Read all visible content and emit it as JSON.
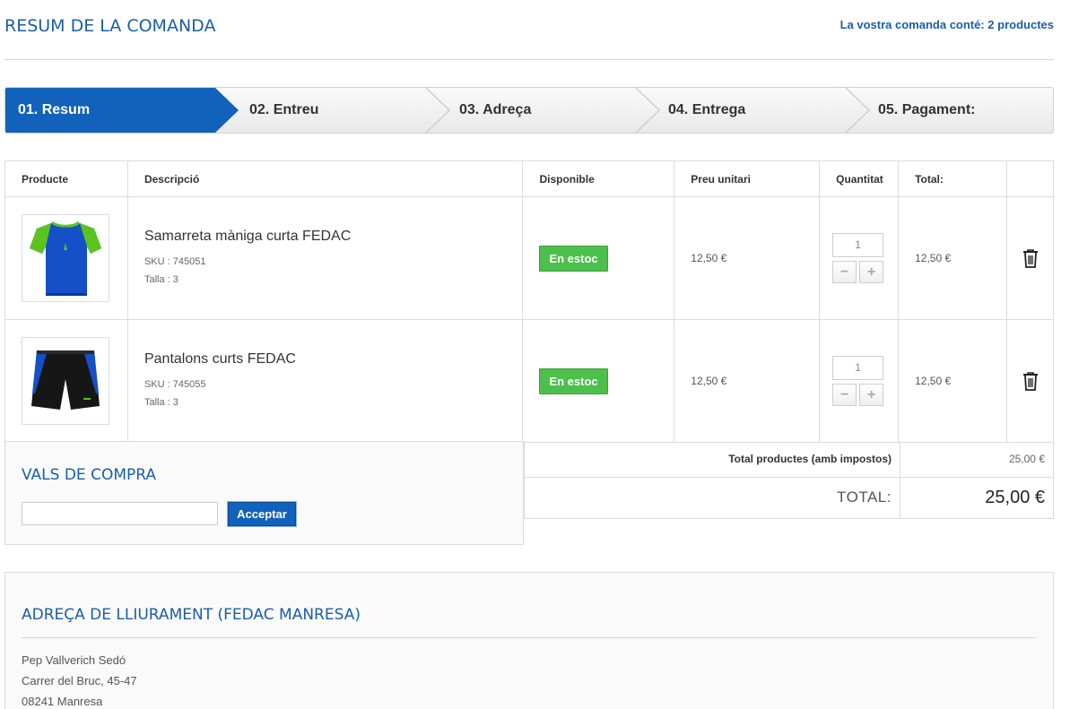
{
  "header": {
    "title": "RESUM DE LA COMANDA",
    "order_count": "La vostra comanda conté: 2 productes"
  },
  "steps": [
    {
      "label": "01. Resum",
      "active": true
    },
    {
      "label": "02. Entreu",
      "active": false
    },
    {
      "label": "03. Adreça",
      "active": false
    },
    {
      "label": "04. Entrega",
      "active": false
    },
    {
      "label": "05. Pagament:",
      "active": false
    }
  ],
  "table": {
    "headers": [
      "Producte",
      "Descripció",
      "Disponible",
      "Preu unitari",
      "Quantitat",
      "Total:"
    ],
    "rows": [
      {
        "image_icon": "tshirt-image",
        "name": "Samarreta màniga curta FEDAC",
        "sku": "SKU : 745051",
        "size": "Talla : 3",
        "availability": "En estoc",
        "unit_price": "12,50 €",
        "quantity": "1",
        "total": "12,50 €"
      },
      {
        "image_icon": "shorts-image",
        "name": "Pantalons curts FEDAC",
        "sku": "SKU : 745055",
        "size": "Talla : 3",
        "availability": "En estoc",
        "unit_price": "12,50 €",
        "quantity": "1",
        "total": "12,50 €"
      }
    ]
  },
  "vouchers": {
    "title": "VALS DE COMPRA",
    "input_value": "",
    "button_label": "Acceptar"
  },
  "totals": {
    "products_label": "Total productes (amb impostos)",
    "products_value": "25,00 €",
    "total_label": "TOTAL:",
    "total_value": "25,00 €"
  },
  "address": {
    "title": "ADREÇA DE LLIURAMENT (FEDAC MANRESA)",
    "lines": [
      "Pep Vallverich Sedó",
      "Carrer del Bruc, 45-47",
      "08241 Manresa"
    ]
  },
  "colors": {
    "accent": "#1262bb",
    "title_blue": "#1a5ea8",
    "stock_green": "#4cbf4c"
  }
}
